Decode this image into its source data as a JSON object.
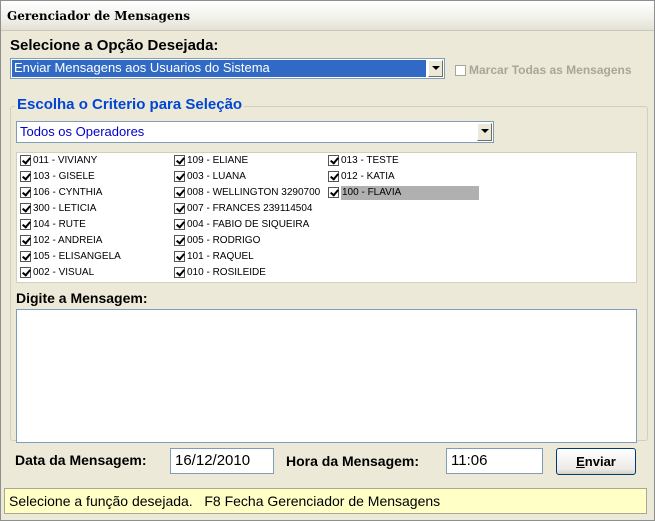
{
  "window": {
    "title": "Gerenciador de Mensagens"
  },
  "option": {
    "label": "Selecione a Opção Desejada:",
    "selected": "Enviar Mensagens aos Usuarios do Sistema",
    "mark_all_label": "Marcar Todas as Mensagens",
    "mark_all_checked": false
  },
  "criteria": {
    "legend": "Escolha o Criterio para Seleção",
    "selected": "Todos os Operadores"
  },
  "operators": {
    "col1": [
      {
        "label": "011 - VIVIANY",
        "checked": true
      },
      {
        "label": "103 - GISELE",
        "checked": true
      },
      {
        "label": "106 - CYNTHIA",
        "checked": true
      },
      {
        "label": "300 - LETICIA",
        "checked": true
      },
      {
        "label": "104 - RUTE",
        "checked": true
      },
      {
        "label": "102 - ANDREIA",
        "checked": true
      },
      {
        "label": "105 - ELISANGELA",
        "checked": true
      },
      {
        "label": "002 - VISUAL",
        "checked": true
      }
    ],
    "col2": [
      {
        "label": "109 - ELIANE",
        "checked": true
      },
      {
        "label": "003 - LUANA",
        "checked": true
      },
      {
        "label": "008 - WELLINGTON 3290700",
        "checked": true
      },
      {
        "label": "007 - FRANCES 239114504",
        "checked": true
      },
      {
        "label": "004 - FABIO DE SIQUEIRA",
        "checked": true
      },
      {
        "label": "005 - RODRIGO",
        "checked": true
      },
      {
        "label": "101 - RAQUEL",
        "checked": true
      },
      {
        "label": "010 - ROSILEIDE",
        "checked": true
      }
    ],
    "col3": [
      {
        "label": "013 - TESTE",
        "checked": true
      },
      {
        "label": "012 - KATIA",
        "checked": true
      },
      {
        "label": "100 - FLAVIA",
        "checked": true
      }
    ]
  },
  "message": {
    "label": "Digite a Mensagem:",
    "text": ""
  },
  "date": {
    "label": "Data da Mensagem:",
    "value": "16/12/2010"
  },
  "time": {
    "label": "Hora da Mensagem:",
    "value": "11:06"
  },
  "send_button": {
    "hotkey": "E",
    "rest": "nviar"
  },
  "status": {
    "text": "Selecione a função desejada.   F8 Fecha Gerenciador de Mensagens"
  }
}
